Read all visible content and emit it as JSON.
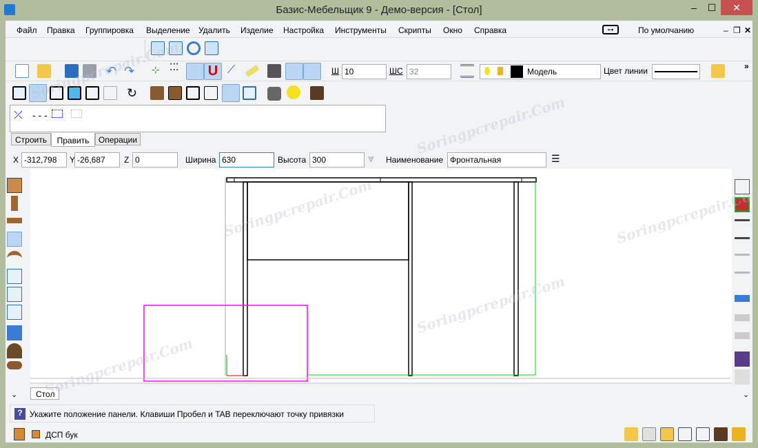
{
  "window": {
    "title": "Базис-Мебельщик 9 - Демо-версия - [Стол]",
    "minimize": "‒",
    "maximize": "☐",
    "close": "✕"
  },
  "menu": [
    "Файл",
    "Правка",
    "Группировка",
    "Выделение",
    "Удалить",
    "Изделие",
    "Настройка",
    "Инструменты",
    "Скрипты",
    "Окно",
    "Справка"
  ],
  "menu_right": {
    "profile": "По умолчанию",
    "key_icon": "key-icon"
  },
  "toolbar": {
    "line_width_label": "Ш",
    "line_width": "10",
    "hatch_label": "ШС",
    "hatch_value": "32",
    "layer": "Модель",
    "line_color_label": "Цвет линии",
    "more": "»"
  },
  "panel_tabs": [
    "Строить",
    "Править",
    "Операции"
  ],
  "active_panel_tab": 1,
  "coords": {
    "x_label": "X",
    "x": "-312,798",
    "y_label": "Y",
    "y": "-26,687",
    "z_label": "Z",
    "z": "0",
    "width_label": "Ширина",
    "width": "630",
    "height_label": "Высота",
    "height": "300",
    "name_label": "Наименование",
    "name": "Фронтальная"
  },
  "document_tab": "Стол",
  "status": {
    "hint": "Укажите положение панели. Клавиши Пробел и TAB переключают точку привязки",
    "material": "ДСП бук"
  },
  "colors": {
    "accent": "#b9d6f2",
    "magenta": "#ff00ff",
    "green": "#00dd00",
    "chrome": "#b1bd9c"
  },
  "watermark": "Soringpcrepair.Com"
}
